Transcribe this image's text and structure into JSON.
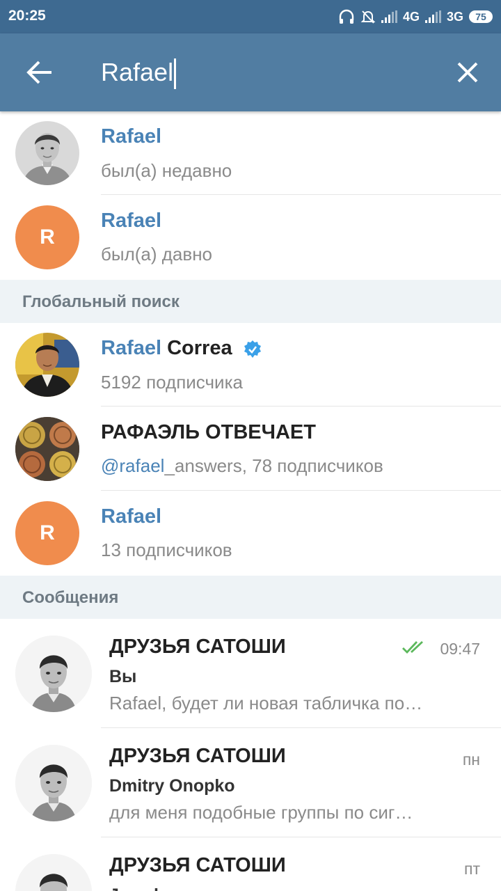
{
  "status_bar": {
    "time": "20:25",
    "network_1": "4G",
    "network_2": "3G",
    "battery": "75",
    "icons": [
      "headphones-icon",
      "bell-off-icon",
      "signal-icon",
      "signal-icon",
      "battery-icon"
    ]
  },
  "toolbar": {
    "search_value": "Rafael",
    "back_icon": "arrow-left-icon",
    "clear_icon": "close-icon"
  },
  "contacts": [
    {
      "name": "Rafael",
      "status": "был(а) недавно",
      "avatar": "photo"
    },
    {
      "name": "Rafael",
      "status": "был(а) давно",
      "avatar_letter": "R"
    }
  ],
  "global_search": {
    "header": "Глобальный поиск",
    "items": [
      {
        "name_match": "Rafael",
        "name_rest": " Correa",
        "verified": true,
        "subtitle": "5192 подписчика"
      },
      {
        "name": "РАФАЭЛЬ ОТВЕЧАЕТ",
        "subtitle_link": "@rafael",
        "subtitle_rest": "_answers, 78 подписчиков"
      },
      {
        "name": "Rafael",
        "avatar_letter": "R",
        "subtitle": "13 подписчиков"
      }
    ]
  },
  "messages": {
    "header": "Сообщения",
    "items": [
      {
        "title": "ДРУЗЬЯ САТОШИ",
        "sender": "Вы",
        "text": "Rafael, будет ли новая табличка по…",
        "time": "09:47",
        "read": true
      },
      {
        "title": "ДРУЗЬЯ САТОШИ",
        "sender": "Dmitry Onopko",
        "text": "для меня подобные группы по сиг…",
        "time": "пн"
      },
      {
        "title": "ДРУЗЬЯ САТОШИ",
        "sender": "Jamal",
        "text": "",
        "time": "пт"
      }
    ]
  },
  "colors": {
    "status_bar": "#3e6a91",
    "app_bar": "#517da2",
    "accent_blue": "#4a83b6",
    "letter_avatar": "#f08c4d",
    "section_bg": "#eef3f6",
    "read_check": "#5cb85c",
    "verified": "#3aa0e8"
  }
}
